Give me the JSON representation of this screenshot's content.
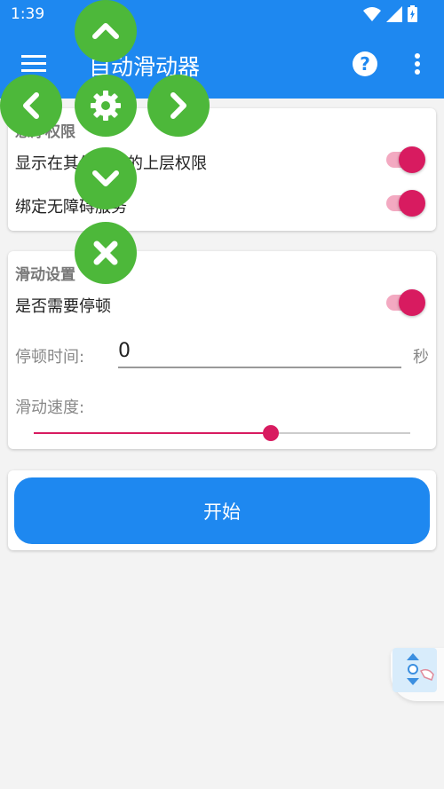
{
  "status": {
    "time": "1:39"
  },
  "appbar": {
    "title": "自动滑动器"
  },
  "permissions": {
    "section_title": "悬浮权限",
    "overlay_label": "显示在其他应用的上层权限",
    "overlay_enabled": true,
    "accessibility_label": "绑定无障碍服务",
    "accessibility_enabled": true
  },
  "slide_settings": {
    "section_title": "滑动设置",
    "pause_label": "是否需要停顿",
    "pause_enabled": true,
    "pause_time_label": "停顿时间:",
    "pause_time_value": "0",
    "pause_time_unit": "秒",
    "speed_label": "滑动速度:",
    "speed_fraction": 0.63
  },
  "start_button": {
    "label": "开始"
  },
  "floating_controls": [
    "chevron-up-icon",
    "chevron-left-icon",
    "gear-icon",
    "chevron-right-icon",
    "chevron-down-icon",
    "close-icon"
  ],
  "colors": {
    "primary": "#1e88f0",
    "accent": "#d81b60",
    "control_green": "#4db83a"
  }
}
